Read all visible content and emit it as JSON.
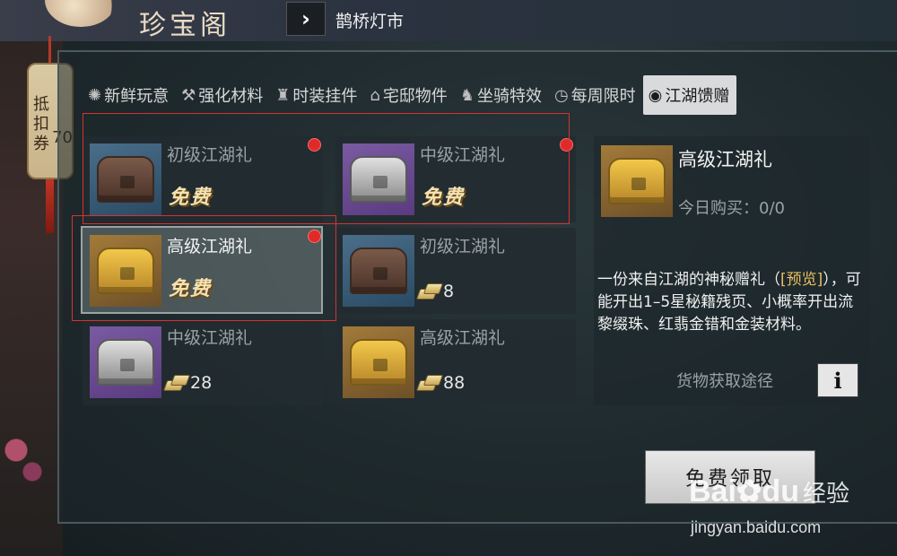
{
  "header": {
    "title": "珍宝阁",
    "nav_link": "鹊桥灯市"
  },
  "coupon": {
    "label": "抵扣券",
    "count": "70"
  },
  "tabs": [
    {
      "label": "新鲜玩意",
      "icon": "sparkle-icon",
      "active": false
    },
    {
      "label": "强化材料",
      "icon": "hammer-icon",
      "active": false
    },
    {
      "label": "时装挂件",
      "icon": "robe-icon",
      "active": false
    },
    {
      "label": "宅邸物件",
      "icon": "house-icon",
      "active": false
    },
    {
      "label": "坐骑特效",
      "icon": "horse-icon",
      "active": false
    },
    {
      "label": "每周限时",
      "icon": "stopwatch-icon",
      "active": false
    },
    {
      "label": "江湖馈赠",
      "icon": "target-icon",
      "active": true
    }
  ],
  "items": [
    {
      "name": "初级江湖礼",
      "tier": "brown",
      "free_label": "免费",
      "price": null,
      "red_dot": true,
      "selected": false
    },
    {
      "name": "中级江湖礼",
      "tier": "silver",
      "free_label": "免费",
      "price": null,
      "red_dot": true,
      "selected": false
    },
    {
      "name": "高级江湖礼",
      "tier": "gold",
      "free_label": "免费",
      "price": null,
      "red_dot": true,
      "selected": true
    },
    {
      "name": "初级江湖礼",
      "tier": "brown",
      "free_label": null,
      "price": "8",
      "red_dot": false,
      "selected": false
    },
    {
      "name": "中级江湖礼",
      "tier": "silver",
      "free_label": null,
      "price": "28",
      "red_dot": false,
      "selected": false
    },
    {
      "name": "高级江湖礼",
      "tier": "gold",
      "free_label": null,
      "price": "88",
      "red_dot": false,
      "selected": false
    }
  ],
  "detail": {
    "name": "高级江湖礼",
    "bought_today": "今日购买：0/0",
    "desc_before": "一份来自江湖的神秘赠礼（",
    "desc_link": "[预览]",
    "desc_after": "），可能开出1–5星秘籍残页、小概率开出流黎缀珠、红翡金错和金装材料。",
    "source_label": "货物获取途径",
    "info_label": "i",
    "claim_label": "免费领取"
  },
  "watermark": {
    "logo": "Bai",
    "logo_tail": "du",
    "sub": "经验",
    "url": "jingyan.baidu.com"
  },
  "colors": {
    "red_dot": "#e02a2a",
    "highlight": "#d93030",
    "link": "#e8c060"
  }
}
